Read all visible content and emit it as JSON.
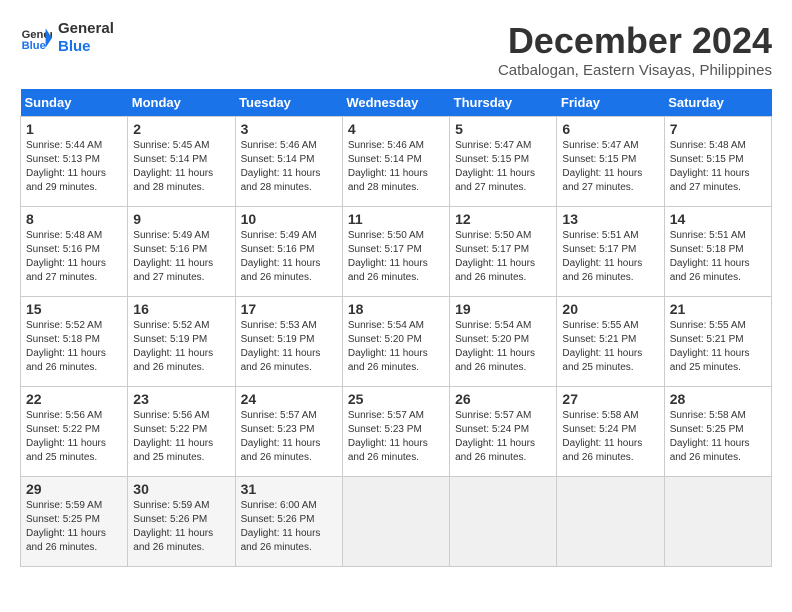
{
  "logo": {
    "line1": "General",
    "line2": "Blue"
  },
  "title": "December 2024",
  "location": "Catbalogan, Eastern Visayas, Philippines",
  "headers": [
    "Sunday",
    "Monday",
    "Tuesday",
    "Wednesday",
    "Thursday",
    "Friday",
    "Saturday"
  ],
  "weeks": [
    [
      {
        "day": "1",
        "info": "Sunrise: 5:44 AM\nSunset: 5:13 PM\nDaylight: 11 hours\nand 29 minutes."
      },
      {
        "day": "2",
        "info": "Sunrise: 5:45 AM\nSunset: 5:14 PM\nDaylight: 11 hours\nand 28 minutes."
      },
      {
        "day": "3",
        "info": "Sunrise: 5:46 AM\nSunset: 5:14 PM\nDaylight: 11 hours\nand 28 minutes."
      },
      {
        "day": "4",
        "info": "Sunrise: 5:46 AM\nSunset: 5:14 PM\nDaylight: 11 hours\nand 28 minutes."
      },
      {
        "day": "5",
        "info": "Sunrise: 5:47 AM\nSunset: 5:15 PM\nDaylight: 11 hours\nand 27 minutes."
      },
      {
        "day": "6",
        "info": "Sunrise: 5:47 AM\nSunset: 5:15 PM\nDaylight: 11 hours\nand 27 minutes."
      },
      {
        "day": "7",
        "info": "Sunrise: 5:48 AM\nSunset: 5:15 PM\nDaylight: 11 hours\nand 27 minutes."
      }
    ],
    [
      {
        "day": "8",
        "info": "Sunrise: 5:48 AM\nSunset: 5:16 PM\nDaylight: 11 hours\nand 27 minutes."
      },
      {
        "day": "9",
        "info": "Sunrise: 5:49 AM\nSunset: 5:16 PM\nDaylight: 11 hours\nand 27 minutes."
      },
      {
        "day": "10",
        "info": "Sunrise: 5:49 AM\nSunset: 5:16 PM\nDaylight: 11 hours\nand 26 minutes."
      },
      {
        "day": "11",
        "info": "Sunrise: 5:50 AM\nSunset: 5:17 PM\nDaylight: 11 hours\nand 26 minutes."
      },
      {
        "day": "12",
        "info": "Sunrise: 5:50 AM\nSunset: 5:17 PM\nDaylight: 11 hours\nand 26 minutes."
      },
      {
        "day": "13",
        "info": "Sunrise: 5:51 AM\nSunset: 5:17 PM\nDaylight: 11 hours\nand 26 minutes."
      },
      {
        "day": "14",
        "info": "Sunrise: 5:51 AM\nSunset: 5:18 PM\nDaylight: 11 hours\nand 26 minutes."
      }
    ],
    [
      {
        "day": "15",
        "info": "Sunrise: 5:52 AM\nSunset: 5:18 PM\nDaylight: 11 hours\nand 26 minutes."
      },
      {
        "day": "16",
        "info": "Sunrise: 5:52 AM\nSunset: 5:19 PM\nDaylight: 11 hours\nand 26 minutes."
      },
      {
        "day": "17",
        "info": "Sunrise: 5:53 AM\nSunset: 5:19 PM\nDaylight: 11 hours\nand 26 minutes."
      },
      {
        "day": "18",
        "info": "Sunrise: 5:54 AM\nSunset: 5:20 PM\nDaylight: 11 hours\nand 26 minutes."
      },
      {
        "day": "19",
        "info": "Sunrise: 5:54 AM\nSunset: 5:20 PM\nDaylight: 11 hours\nand 26 minutes."
      },
      {
        "day": "20",
        "info": "Sunrise: 5:55 AM\nSunset: 5:21 PM\nDaylight: 11 hours\nand 25 minutes."
      },
      {
        "day": "21",
        "info": "Sunrise: 5:55 AM\nSunset: 5:21 PM\nDaylight: 11 hours\nand 25 minutes."
      }
    ],
    [
      {
        "day": "22",
        "info": "Sunrise: 5:56 AM\nSunset: 5:22 PM\nDaylight: 11 hours\nand 25 minutes."
      },
      {
        "day": "23",
        "info": "Sunrise: 5:56 AM\nSunset: 5:22 PM\nDaylight: 11 hours\nand 25 minutes."
      },
      {
        "day": "24",
        "info": "Sunrise: 5:57 AM\nSunset: 5:23 PM\nDaylight: 11 hours\nand 26 minutes."
      },
      {
        "day": "25",
        "info": "Sunrise: 5:57 AM\nSunset: 5:23 PM\nDaylight: 11 hours\nand 26 minutes."
      },
      {
        "day": "26",
        "info": "Sunrise: 5:57 AM\nSunset: 5:24 PM\nDaylight: 11 hours\nand 26 minutes."
      },
      {
        "day": "27",
        "info": "Sunrise: 5:58 AM\nSunset: 5:24 PM\nDaylight: 11 hours\nand 26 minutes."
      },
      {
        "day": "28",
        "info": "Sunrise: 5:58 AM\nSunset: 5:25 PM\nDaylight: 11 hours\nand 26 minutes."
      }
    ],
    [
      {
        "day": "29",
        "info": "Sunrise: 5:59 AM\nSunset: 5:25 PM\nDaylight: 11 hours\nand 26 minutes."
      },
      {
        "day": "30",
        "info": "Sunrise: 5:59 AM\nSunset: 5:26 PM\nDaylight: 11 hours\nand 26 minutes."
      },
      {
        "day": "31",
        "info": "Sunrise: 6:00 AM\nSunset: 5:26 PM\nDaylight: 11 hours\nand 26 minutes."
      },
      {
        "day": "",
        "info": ""
      },
      {
        "day": "",
        "info": ""
      },
      {
        "day": "",
        "info": ""
      },
      {
        "day": "",
        "info": ""
      }
    ]
  ]
}
